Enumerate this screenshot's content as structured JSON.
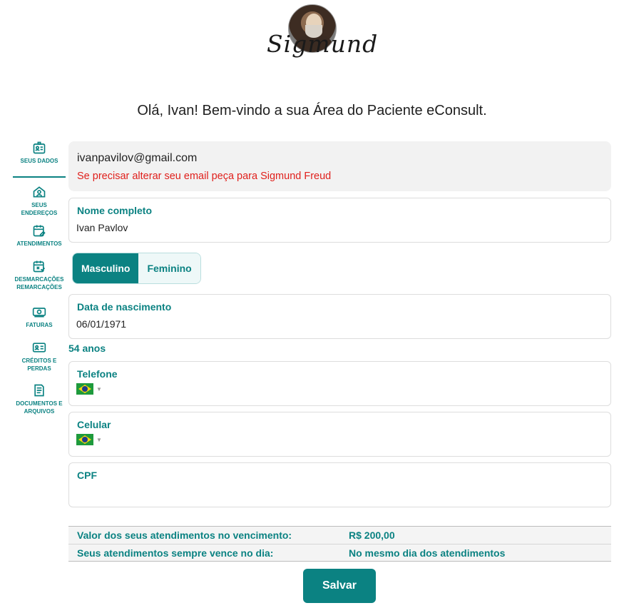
{
  "brand": {
    "name": "Sigmund"
  },
  "welcome": "Olá, Ivan! Bem-vindo a sua Área do Paciente eConsult.",
  "sidebar": {
    "items": [
      {
        "label": "SEUS DADOS",
        "icon": "id-card-icon",
        "active": true
      },
      {
        "label": "SEUS ENDEREÇOS",
        "icon": "home-user-icon"
      },
      {
        "label": "ATENDIMENTOS",
        "icon": "calendar-edit-icon"
      },
      {
        "label": "DESMARCAÇÕES REMARCAÇÕES",
        "icon": "calendar-x-icon"
      },
      {
        "label": "FATURAS",
        "icon": "money-icon"
      },
      {
        "label": "CRÉDITOS E PERDAS",
        "icon": "wallet-card-icon"
      },
      {
        "label": "DOCUMENTOS E ARQUIVOS",
        "icon": "document-icon"
      }
    ]
  },
  "email": {
    "value": "ivanpavilov@gmail.com",
    "note": "Se precisar alterar seu email peça para Sigmund Freud"
  },
  "fields": {
    "full_name": {
      "label": "Nome completo",
      "value": "Ivan Pavlov"
    },
    "birth_date": {
      "label": "Data de nascimento",
      "value": "06/01/1971"
    },
    "age": "54 anos",
    "phone": {
      "label": "Telefone",
      "country": "Brasil"
    },
    "mobile": {
      "label": "Celular",
      "country": "Brasil"
    },
    "cpf": {
      "label": "CPF",
      "value": ""
    }
  },
  "gender": {
    "options": [
      "Masculino",
      "Feminino"
    ],
    "selected": "Masculino"
  },
  "billing": {
    "rows": [
      {
        "label": "Valor dos seus atendimentos no vencimento:",
        "value": "R$ 200,00"
      },
      {
        "label": "Seus atendimentos sempre vence no dia:",
        "value": "No mesmo dia dos atendimentos"
      }
    ]
  },
  "actions": {
    "save_label": "Salvar"
  },
  "colors": {
    "accent": "#0b8282",
    "warning": "#e0201c",
    "panel": "#f2f2f2"
  }
}
